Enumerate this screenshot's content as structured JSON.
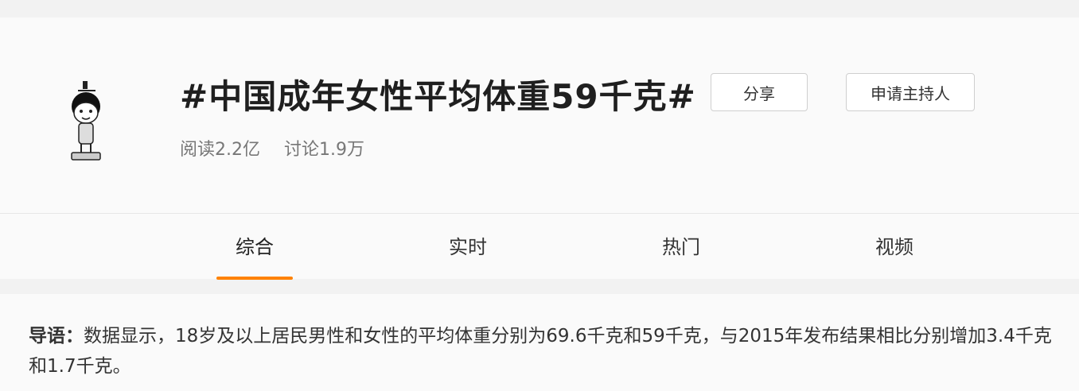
{
  "topic": {
    "title": "#中国成年女性平均体重59千克#",
    "reads": "阅读2.2亿",
    "discussions": "讨论1.9万"
  },
  "buttons": {
    "share": "分享",
    "apply_host": "申请主持人"
  },
  "tabs": [
    {
      "label": "综合",
      "active": true
    },
    {
      "label": "实时",
      "active": false
    },
    {
      "label": "热门",
      "active": false
    },
    {
      "label": "视频",
      "active": false
    }
  ],
  "intro": {
    "label": "导语：",
    "text": "数据显示，18岁及以上居民男性和女性的平均体重分别为69.6千克和59千克，与2015年发布结果相比分别增加3.4千克和1.7千克。"
  },
  "colors": {
    "accent": "#ff8200"
  }
}
